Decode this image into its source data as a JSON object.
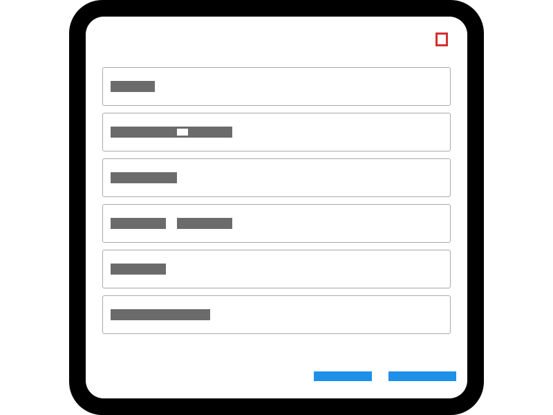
{
  "dialog": {
    "close_button": {
      "label": "",
      "icon": "close-icon",
      "color": "#d32f2f"
    },
    "fields": [
      {
        "label_segments": [
          ""
        ]
      },
      {
        "label_segments": [
          "",
          ""
        ]
      },
      {
        "label_segments": [
          ""
        ]
      },
      {
        "label_segments": [
          "",
          ""
        ]
      },
      {
        "label_segments": [
          ""
        ]
      },
      {
        "label_segments": [
          ""
        ]
      }
    ],
    "actions": {
      "secondary_label": "",
      "primary_label": "",
      "color": "#1e90e8"
    }
  }
}
